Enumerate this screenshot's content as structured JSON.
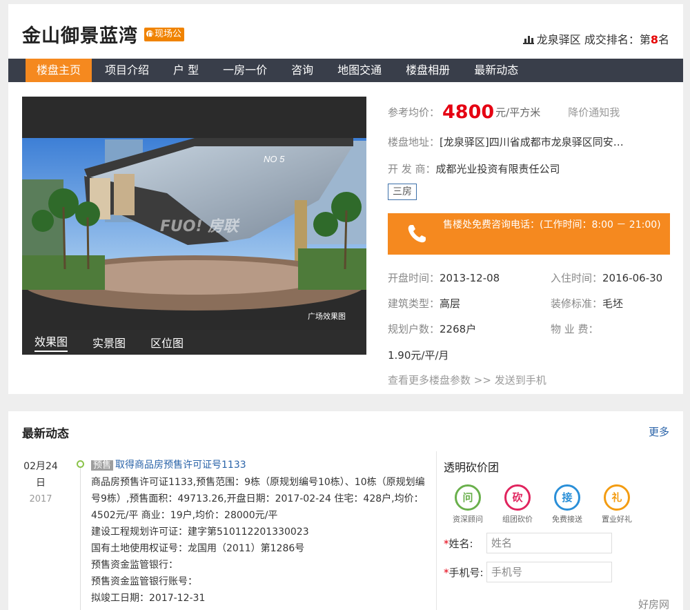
{
  "header": {
    "title": "金山御景蓝湾",
    "badge": "现场公",
    "district": "龙泉驿区",
    "rank_label": "成交排名：第",
    "rank_value": "8",
    "rank_suffix": "名"
  },
  "nav": {
    "items": [
      "楼盘主页",
      "项目介绍",
      "户 型",
      "一房一价",
      "咨询",
      "地图交通",
      "楼盘相册",
      "最新动态"
    ],
    "active": 0
  },
  "gallery": {
    "tabs": [
      "效果图",
      "实景图",
      "区位图"
    ],
    "active": 0,
    "caption": "广场效果图",
    "watermark": "FUO! 房联"
  },
  "info": {
    "price_label": "参考均价：",
    "price_value": "4800",
    "price_unit": "元/平方米",
    "notify": "降价通知我",
    "address_label": "楼盘地址：",
    "address_value": "[龙泉驿区]四川省成都市龙泉驿区同安…",
    "developer_label": "开 发 商：",
    "developer_value": "成都光业投资有限责任公司",
    "tag": "三房",
    "phone_text": "售楼处免费咨询电话：(工作时间：8:00 － 21:00)",
    "open_label": "开盘时间：",
    "open_value": "2013-12-08",
    "move_label": "入住时间：",
    "move_value": "2016-06-30",
    "type_label": "建筑类型：",
    "type_value": "高层",
    "deco_label": "装修标准：",
    "deco_value": "毛坯",
    "households_label": "规划户数：",
    "households_value": "2268户",
    "fee_label": "物 业 费：",
    "fee_value": "1.90元/平/月",
    "more_params": "查看更多楼盘参数",
    "arrow": ">>",
    "send_phone": "发送到手机"
  },
  "news_section": {
    "title": "最新动态",
    "more": "更多",
    "date_md": "02月24",
    "date_day": "日",
    "date_year": "2017",
    "tag": "预售",
    "headline": "取得商品房预售许可证号1133",
    "lines": [
      "商品房预售许可证1133,预售范围：9栋（原规划编号10栋）、10栋（原规划编号9栋）,预售面积：49713.26,开盘日期：2017-02-24 住宅：428户,均价：4502元/平 商业：19户,均价：28000元/平",
      "建设工程规划许可证：建字第510112201330023",
      "国有土地使用权证号：龙国用（2011）第1286号",
      "预售资金监管银行：",
      "预售资金监管银行账号：",
      "拟竣工日期：2017-12-31"
    ]
  },
  "team": {
    "title": "透明砍价团",
    "icons": [
      {
        "char": "问",
        "label": "资深顾问",
        "color": "#6ab04c",
        "icon": "consult-icon"
      },
      {
        "char": "砍",
        "label": "组团砍价",
        "color": "#e0245e",
        "icon": "bargain-icon"
      },
      {
        "char": "接",
        "label": "免费接送",
        "color": "#2a8fd8",
        "icon": "shuttle-icon"
      },
      {
        "char": "礼",
        "label": "置业好礼",
        "color": "#f39c12",
        "icon": "gift-icon"
      }
    ],
    "name_label": "姓名:",
    "name_placeholder": "姓名",
    "phone_label": "手机号:",
    "phone_placeholder": "手机号",
    "required": "*"
  },
  "footer_logo": "好房网"
}
